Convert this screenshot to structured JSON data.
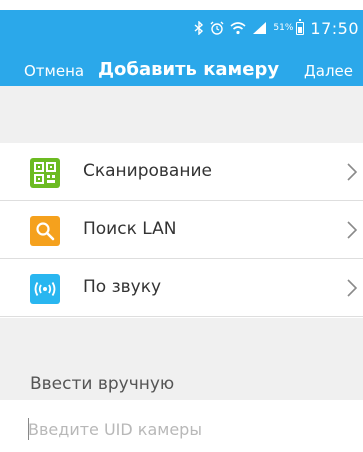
{
  "status_bar": {
    "battery_pct": "51%",
    "time": "17:50"
  },
  "nav": {
    "cancel": "Отмена",
    "title": "Добавить камеру",
    "next": "Далее"
  },
  "methods": [
    {
      "label": "Сканирование",
      "icon": "qr-code-icon",
      "color": "#6cbb22"
    },
    {
      "label": "Поиск LAN",
      "icon": "search-icon",
      "color": "#f5a11d"
    },
    {
      "label": "По звуку",
      "icon": "sound-wave-icon",
      "color": "#29b6f0"
    }
  ],
  "manual": {
    "label": "Ввести вручную",
    "placeholder": "Введите UID камеры"
  },
  "colors": {
    "header": "#2ba8ea",
    "background": "#f0f0f0"
  }
}
